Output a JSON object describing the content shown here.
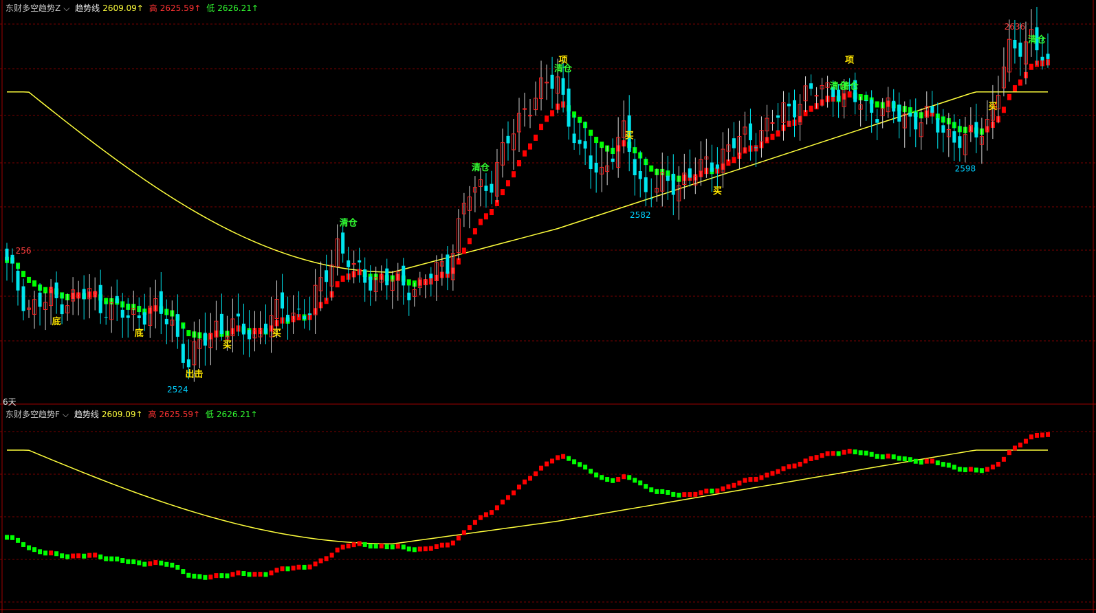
{
  "panels": {
    "top": {
      "indicator_name": "东财多空趋势Z",
      "arrow_icon": "chevron-down-icon",
      "trend_label": "趋势线",
      "trend_value": "2609.09↑",
      "high_label": "高",
      "high_value": "2625.59↑",
      "low_label": "低",
      "low_value": "2626.21↑",
      "period_label": "6天"
    },
    "bottom": {
      "indicator_name": "东财多空趋势F",
      "arrow_icon": "chevron-down-icon",
      "trend_label": "趋势线",
      "trend_value": "2609.09↑",
      "high_label": "高",
      "high_value": "2625.59↑",
      "low_label": "低",
      "low_value": "2626.21↑"
    }
  },
  "colors": {
    "background": "#000000",
    "up_candle": "#ff2020",
    "down_candle": "#00e5ee",
    "trend_line": "#ffff3c",
    "bull_block": "#ff0000",
    "bear_block": "#00ff00",
    "grid": "#7a0000",
    "signal_yellow": "#ffe600",
    "signal_green": "#32ff32",
    "low_mark": "#00d0ff",
    "high_mark": "#ff4040"
  },
  "chart_data": [
    {
      "type": "candlestick",
      "ylim": [
        2515,
        2645
      ],
      "price_marks": [
        {
          "text": "256",
          "price": 2563,
          "index": 3,
          "color": "high"
        },
        {
          "text": "2524",
          "price": 2520,
          "index": 31,
          "color": "low"
        },
        {
          "text": "2582",
          "price": 2580,
          "index": 115,
          "color": "low"
        },
        {
          "text": "2598",
          "price": 2596,
          "index": 174,
          "color": "low"
        },
        {
          "text": "2636",
          "price": 2640,
          "index": 183,
          "color": "high"
        }
      ],
      "signals": [
        {
          "text": "底",
          "price": 2540,
          "index": 8,
          "color": "yellow"
        },
        {
          "text": "底",
          "price": 2536,
          "index": 23,
          "color": "yellow"
        },
        {
          "text": "出击",
          "price": 2522,
          "index": 33,
          "color": "yellow"
        },
        {
          "text": "买",
          "price": 2532,
          "index": 39,
          "color": "yellow"
        },
        {
          "text": "买",
          "price": 2536,
          "index": 48,
          "color": "yellow"
        },
        {
          "text": "清仓",
          "price": 2574,
          "index": 61,
          "color": "green"
        },
        {
          "text": "清仓",
          "price": 2593,
          "index": 85,
          "color": "green"
        },
        {
          "text": "项",
          "price": 2630,
          "index": 100,
          "color": "yellow"
        },
        {
          "text": "清仓",
          "price": 2627,
          "index": 100,
          "color": "green"
        },
        {
          "text": "买",
          "price": 2604,
          "index": 112,
          "color": "yellow"
        },
        {
          "text": "买",
          "price": 2585,
          "index": 128,
          "color": "yellow"
        },
        {
          "text": "项",
          "price": 2630,
          "index": 152,
          "color": "yellow"
        },
        {
          "text": "清仓",
          "price": 2621,
          "index": 150,
          "color": "green"
        },
        {
          "text": "清仓",
          "price": 2621,
          "index": 152,
          "color": "green"
        },
        {
          "text": "买",
          "price": 2614,
          "index": 178,
          "color": "yellow"
        },
        {
          "text": "清仓",
          "price": 2637,
          "index": 186,
          "color": "green"
        }
      ]
    },
    {
      "type": "line",
      "series": [
        {
          "values_source": "trend"
        },
        {
          "values_source": "blocks"
        }
      ],
      "ylim": [
        2515,
        2645
      ]
    }
  ]
}
